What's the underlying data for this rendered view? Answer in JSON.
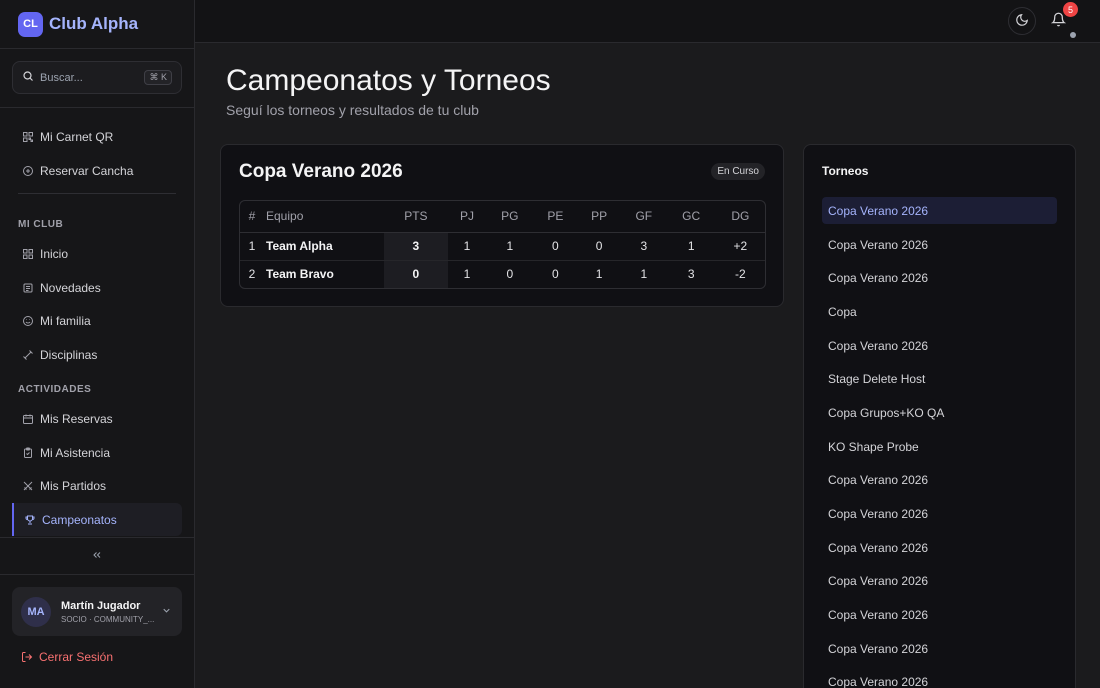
{
  "brand": {
    "logo": "CL",
    "name": "Club Alpha"
  },
  "search": {
    "placeholder": "Buscar...",
    "shortcut": "⌘ K"
  },
  "nav_top": [
    {
      "label": "Mi Carnet QR",
      "icon": "qr-icon"
    },
    {
      "label": "Reservar Cancha",
      "icon": "plus-circle-icon"
    }
  ],
  "sections": {
    "club": "MI CLUB",
    "actividades": "ACTIVIDADES"
  },
  "nav_club": [
    {
      "label": "Inicio",
      "icon": "grid-icon"
    },
    {
      "label": "Novedades",
      "icon": "newspaper-icon"
    },
    {
      "label": "Mi familia",
      "icon": "smile-icon"
    },
    {
      "label": "Disciplinas",
      "icon": "dumbbell-icon"
    }
  ],
  "nav_actividades": [
    {
      "label": "Mis Reservas",
      "icon": "calendar-icon"
    },
    {
      "label": "Mi Asistencia",
      "icon": "clipboard-icon"
    },
    {
      "label": "Mis Partidos",
      "icon": "swords-icon"
    },
    {
      "label": "Campeonatos",
      "icon": "trophy-icon",
      "active": true
    }
  ],
  "user": {
    "initials": "MA",
    "name": "Martín Jugador",
    "role": "SOCIO · COMMUNITY_..."
  },
  "logout_label": "Cerrar Sesión",
  "notifications": {
    "count": "5"
  },
  "page": {
    "title": "Campeonatos y Torneos",
    "subtitle": "Seguí los torneos y resultados de tu club"
  },
  "tournament": {
    "name": "Copa Verano 2026",
    "status": "En Curso",
    "columns": [
      "#",
      "Equipo",
      "PTS",
      "PJ",
      "PG",
      "PE",
      "PP",
      "GF",
      "GC",
      "DG"
    ],
    "rows": [
      [
        "1",
        "Team Alpha",
        "3",
        "1",
        "1",
        "0",
        "0",
        "3",
        "1",
        "+2"
      ],
      [
        "2",
        "Team Bravo",
        "0",
        "1",
        "0",
        "0",
        "1",
        "1",
        "3",
        "-2"
      ]
    ]
  },
  "panel": {
    "title": "Torneos",
    "items": [
      "Copa Verano 2026",
      "Copa Verano 2026",
      "Copa Verano 2026",
      "Copa",
      "Copa Verano 2026",
      "Stage Delete Host",
      "Copa Grupos+KO QA",
      "KO Shape Probe",
      "Copa Verano 2026",
      "Copa Verano 2026",
      "Copa Verano 2026",
      "Copa Verano 2026",
      "Copa Verano 2026",
      "Copa Verano 2026",
      "Copa Verano 2026"
    ],
    "selected_index": 0
  },
  "colors": {
    "accent": "#6366f1",
    "accent_text": "#a5b4fc",
    "danger": "#f87171",
    "badge": "#ef4444"
  }
}
